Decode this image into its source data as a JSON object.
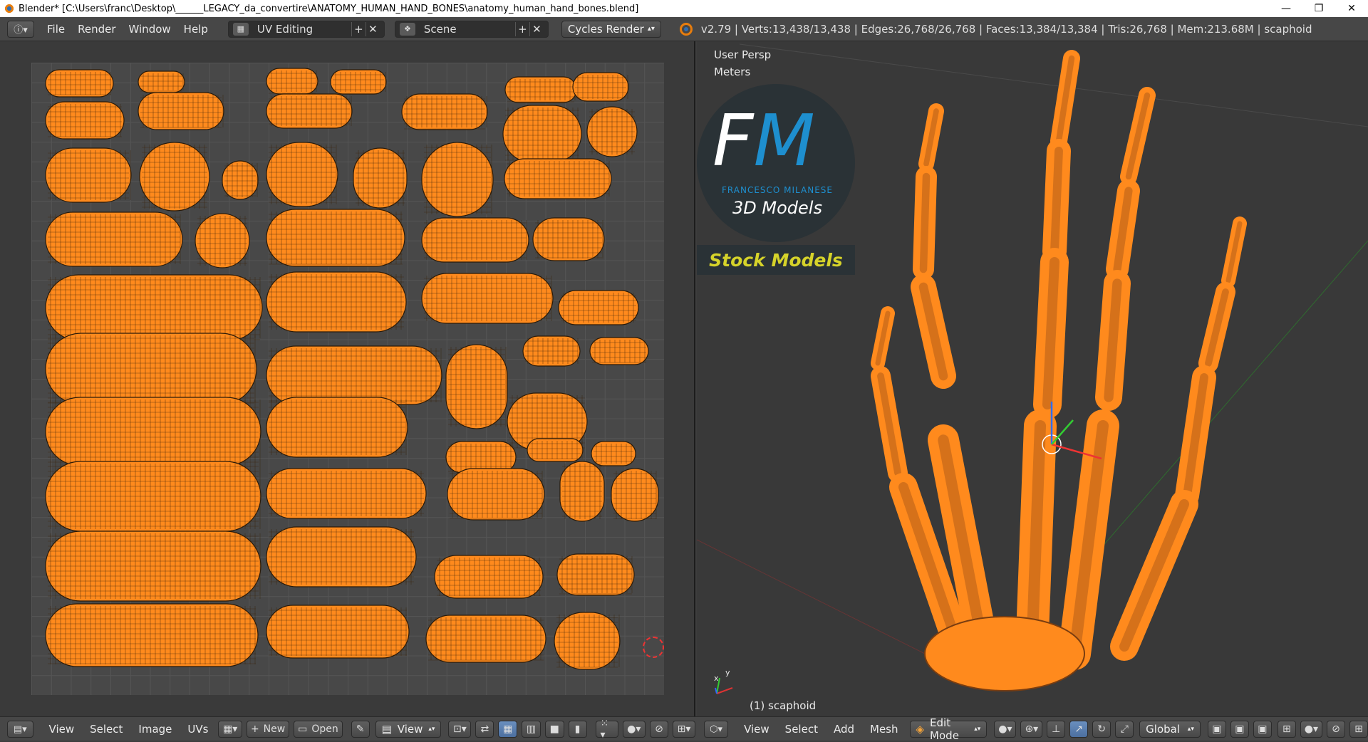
{
  "window": {
    "title": "Blender* [C:\\Users\\franc\\Desktop\\______LEGACY_da_convertire\\ANATOMY_HUMAN_HAND_BONES\\anatomy_human_hand_bones.blend]",
    "controls": [
      "—",
      "❐",
      "✕"
    ]
  },
  "infobar": {
    "menus": [
      "File",
      "Render",
      "Window",
      "Help"
    ],
    "screen_layout": "UV Editing",
    "scene": "Scene",
    "render_engine": "Cycles Render",
    "stats": "v2.79 | Verts:13,438/13,438 | Edges:26,768/26,768 | Faces:13,384/13,384 | Tris:26,768 | Mem:213.68M | scaphoid"
  },
  "uv_editor": {
    "menus": [
      "View",
      "Select",
      "Image",
      "UVs"
    ],
    "new_label": "New",
    "open_label": "Open",
    "view_label": "View"
  },
  "viewport": {
    "view_name": "User Persp",
    "units": "Meters",
    "object_info": "(1) scaphoid",
    "menus": [
      "View",
      "Select",
      "Add",
      "Mesh"
    ],
    "mode": "Edit Mode",
    "orientation": "Global"
  },
  "watermark": {
    "letters": "FM",
    "name": "FRANCESCO MILANESE",
    "subtitle": "3D Models",
    "banner": "Stock Models"
  },
  "axis": {
    "x": "x",
    "y": "y"
  },
  "colors": {
    "accent": "#ff8a1d",
    "uv_bg": "#484848",
    "panel": "#474747",
    "logo_blue": "#1e8fcf",
    "banner_yellow": "#d6d32a"
  }
}
